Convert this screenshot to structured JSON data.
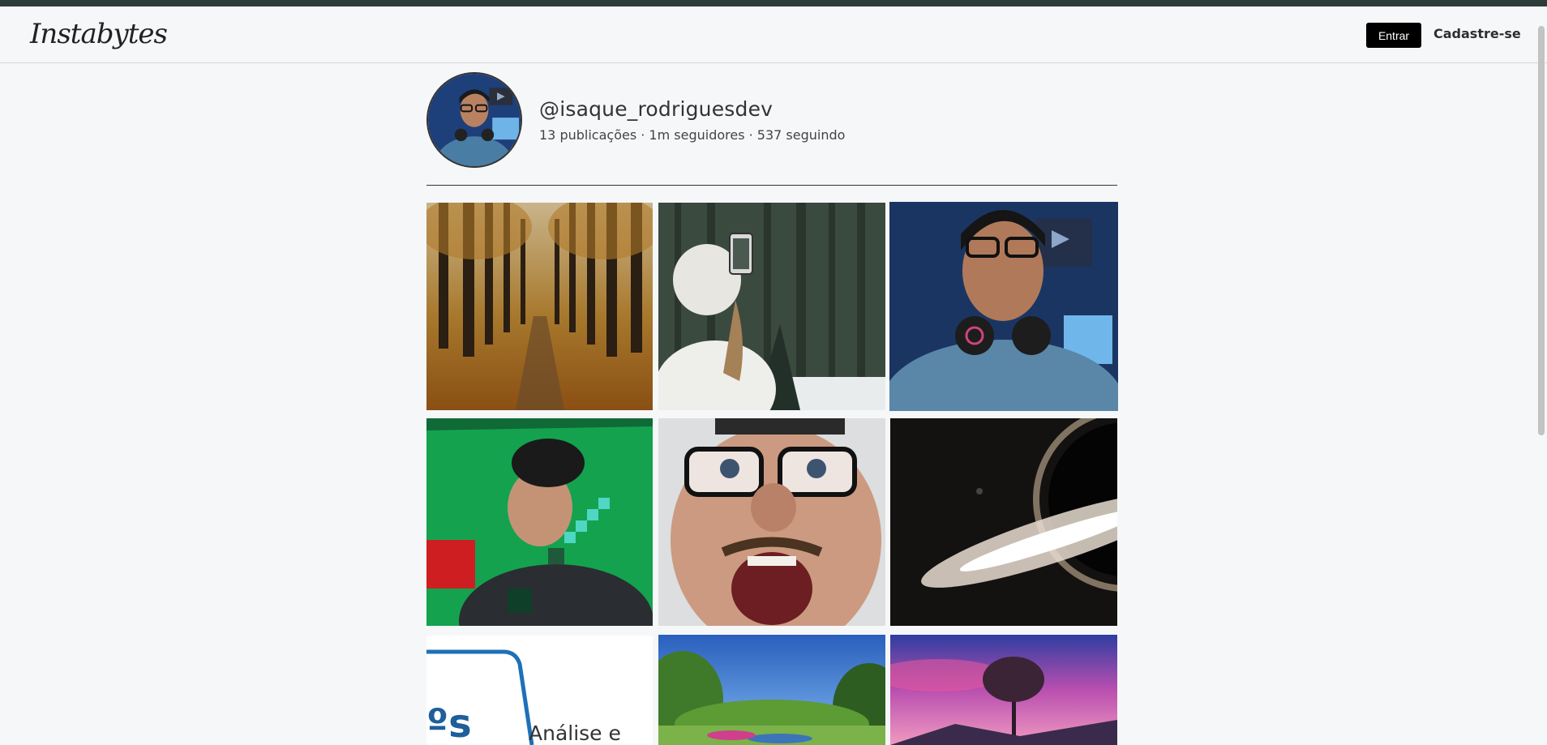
{
  "header": {
    "logo_part1": "Insta",
    "logo_part2": "bytes",
    "login_label": "Entrar",
    "signup_label": "Cadastre-se"
  },
  "profile": {
    "username": "@isaque_rodriguesdev",
    "stats": "13 publicações · 1m seguidores · 537 seguindo"
  },
  "posts": [
    {
      "subject": "autumn forest road"
    },
    {
      "subject": "girl taking selfie in snowy forest"
    },
    {
      "subject": "selfie with headphones"
    },
    {
      "subject": "selfie with pixel sword"
    },
    {
      "subject": "funny face with glasses"
    },
    {
      "subject": "black hole in space"
    },
    {
      "subject": "logo card",
      "text": "Análise e"
    },
    {
      "subject": "green park landscape"
    },
    {
      "subject": "tree at pink sunset"
    }
  ],
  "colors": {
    "accent": "#000000",
    "topstrip": "#2d3b3a",
    "background": "#f6f7f9"
  }
}
